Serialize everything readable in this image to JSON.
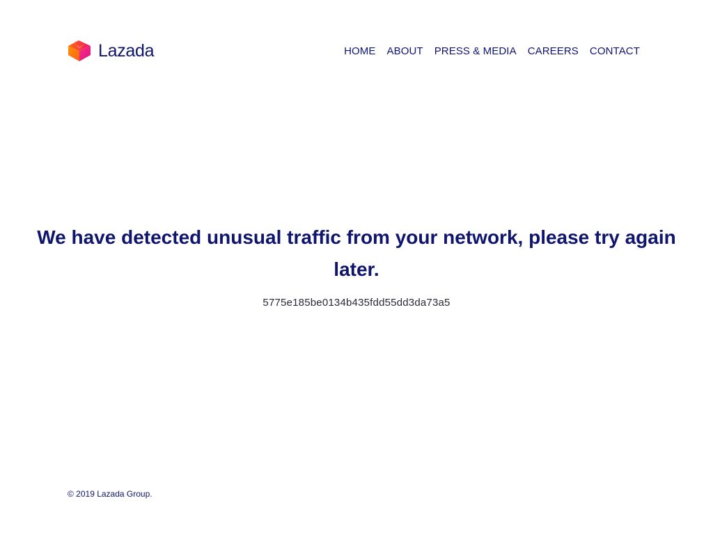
{
  "header": {
    "brand_name": "Lazada",
    "nav": [
      {
        "label": "HOME"
      },
      {
        "label": "ABOUT"
      },
      {
        "label": "PRESS & MEDIA"
      },
      {
        "label": "CAREERS"
      },
      {
        "label": "CONTACT"
      }
    ]
  },
  "main": {
    "headline": "We have detected unusual traffic from your network, please try again later.",
    "trace_id": "5775e185be0134b435fdd55dd3da73a5"
  },
  "footer": {
    "copyright": "© 2019 Lazada Group."
  },
  "icons": {
    "logo": "lazada-heart-icon"
  },
  "colors": {
    "text_primary": "#0f146d",
    "logo_orange": "#f57224",
    "logo_pink": "#f0136e",
    "logo_magenta": "#e2107a"
  }
}
